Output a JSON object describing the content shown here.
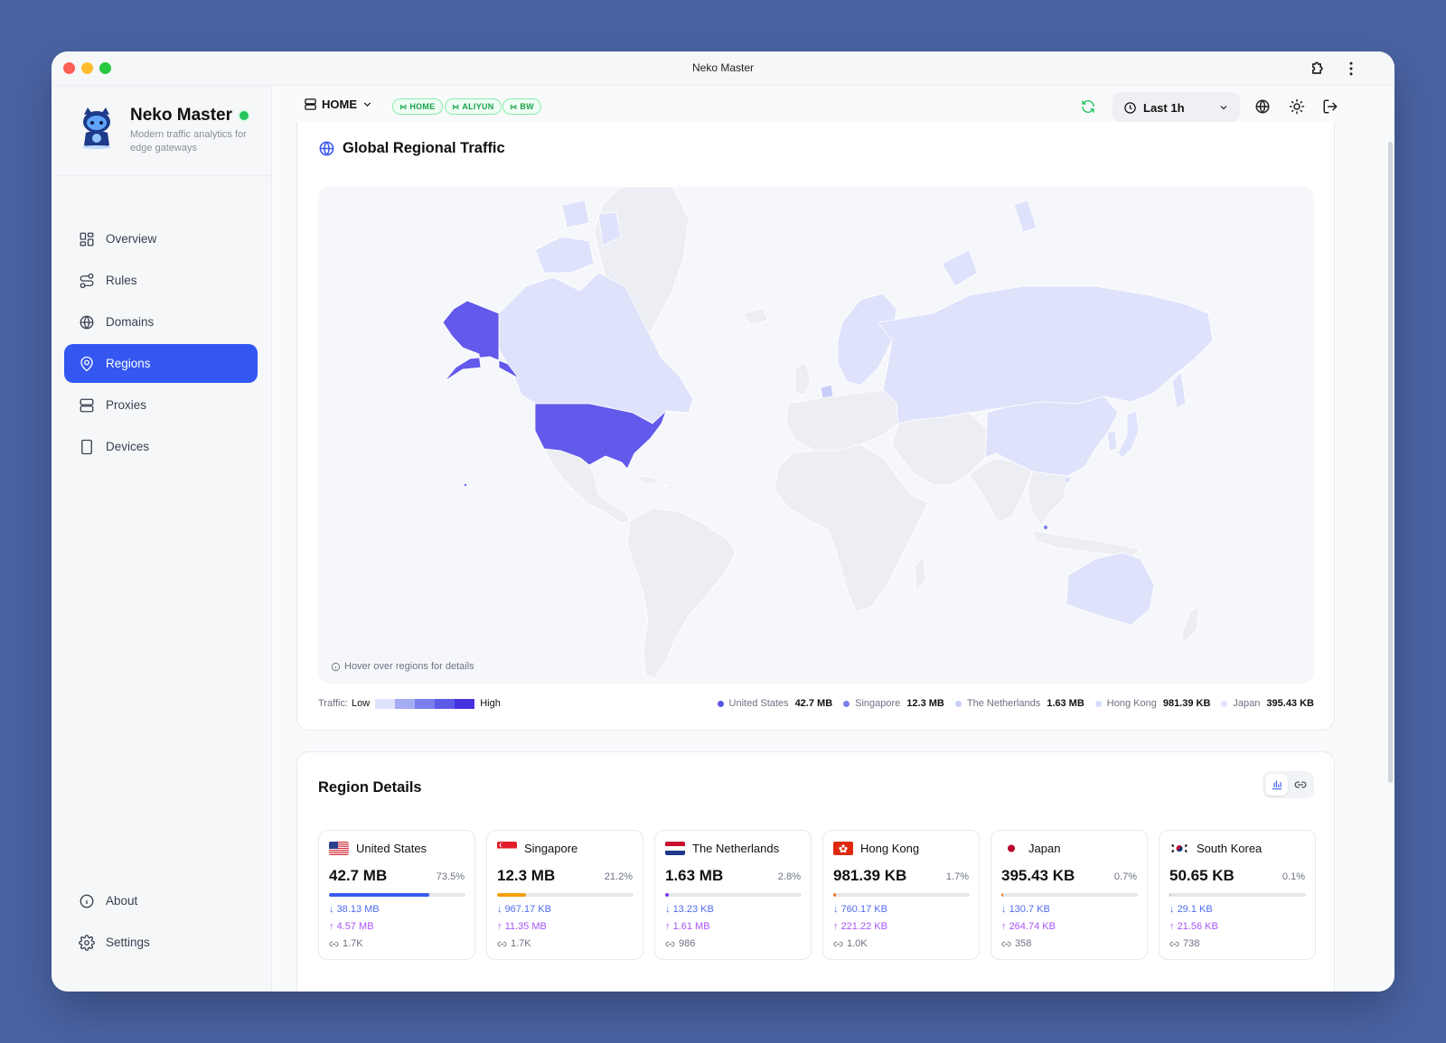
{
  "window": {
    "title": "Neko Master"
  },
  "brand": {
    "name": "Neko Master",
    "tagline": "Modern traffic analytics for edge gateways"
  },
  "nav": {
    "items": [
      {
        "label": "Overview",
        "icon": "layout-grid-icon"
      },
      {
        "label": "Rules",
        "icon": "route-icon"
      },
      {
        "label": "Domains",
        "icon": "globe-icon"
      },
      {
        "label": "Regions",
        "icon": "map-pin-icon",
        "active": true
      },
      {
        "label": "Proxies",
        "icon": "server-icon"
      },
      {
        "label": "Devices",
        "icon": "tablet-icon"
      }
    ],
    "bottom": [
      {
        "label": "About",
        "icon": "info-icon"
      },
      {
        "label": "Settings",
        "icon": "gear-icon"
      }
    ]
  },
  "topbar": {
    "gateway": "HOME",
    "tags": [
      "HOME",
      "ALIYUN",
      "BW"
    ],
    "time_range": "Last 1h"
  },
  "map_card": {
    "title": "Global Regional Traffic",
    "hint": "Hover over regions for details",
    "legend": {
      "label": "Traffic:",
      "low": "Low",
      "high": "High",
      "scale_colors": [
        "#dfe3fb",
        "#a5acf4",
        "#7b7fee",
        "#5d5ae8",
        "#4633e0"
      ]
    },
    "top_regions": [
      {
        "name": "United States",
        "value": "42.7 MB",
        "color": "#5b57e8"
      },
      {
        "name": "Singapore",
        "value": "12.3 MB",
        "color": "#7b7fee"
      },
      {
        "name": "The Netherlands",
        "value": "1.63 MB",
        "color": "#c9cef9"
      },
      {
        "name": "Hong Kong",
        "value": "981.39 KB",
        "color": "#d7dbfa"
      },
      {
        "name": "Japan",
        "value": "395.43 KB",
        "color": "#dfe3fb"
      }
    ],
    "colors": {
      "highest": "#6359ea",
      "medium": "#dfe2fb",
      "none": "#eceef3",
      "border": "#ffffff"
    }
  },
  "details": {
    "title": "Region Details",
    "regions": [
      {
        "name": "United States",
        "total": "42.7 MB",
        "percent": "73.5%",
        "share": 0.735,
        "bar_color": "#3b5bf0",
        "download": "38.13 MB",
        "upload": "4.57 MB",
        "connections": "1.7K",
        "flag": "us-flag"
      },
      {
        "name": "Singapore",
        "total": "12.3 MB",
        "percent": "21.2%",
        "share": 0.212,
        "bar_color": "#f59e0b",
        "download": "967.17 KB",
        "upload": "11.35 MB",
        "connections": "1.7K",
        "flag": "sg-flag"
      },
      {
        "name": "The Netherlands",
        "total": "1.63 MB",
        "percent": "2.8%",
        "share": 0.028,
        "bar_color": "#7c3aed",
        "download": "13.23 KB",
        "upload": "1.61 MB",
        "connections": "986",
        "flag": "nl-flag"
      },
      {
        "name": "Hong Kong",
        "total": "981.39 KB",
        "percent": "1.7%",
        "share": 0.017,
        "bar_color": "#f97316",
        "download": "760.17 KB",
        "upload": "221.22 KB",
        "connections": "1.0K",
        "flag": "hk-flag"
      },
      {
        "name": "Japan",
        "total": "395.43 KB",
        "percent": "0.7%",
        "share": 0.007,
        "bar_color": "#f97316",
        "download": "130.7 KB",
        "upload": "264.74 KB",
        "connections": "358",
        "flag": "jp-flag"
      },
      {
        "name": "South Korea",
        "total": "50.65 KB",
        "percent": "0.1%",
        "share": 0.001,
        "bar_color": "#9ca3af",
        "download": "29.1 KB",
        "upload": "21.56 KB",
        "connections": "738",
        "flag": "kr-flag"
      }
    ],
    "down_arrow": "↓",
    "up_arrow": "↑"
  }
}
